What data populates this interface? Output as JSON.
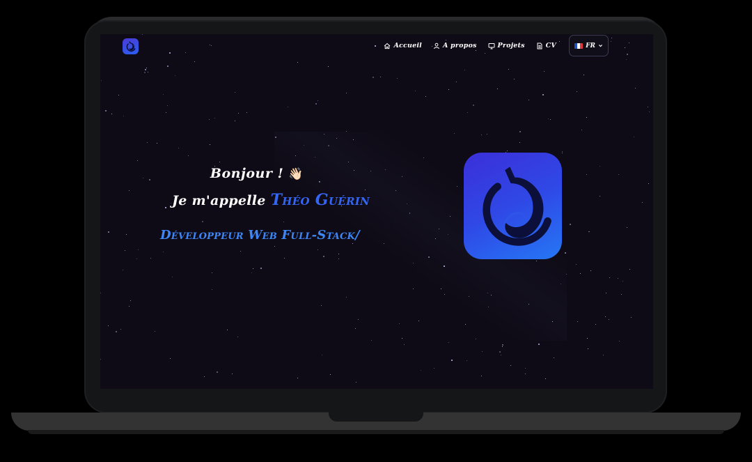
{
  "nav": {
    "items": [
      {
        "label": "Accueil",
        "icon": "home-icon"
      },
      {
        "label": "A propos",
        "icon": "user-icon"
      },
      {
        "label": "Projets",
        "icon": "monitor-icon"
      },
      {
        "label": "CV",
        "icon": "document-icon"
      }
    ],
    "language": {
      "label": "FR",
      "flag": "france-flag-icon"
    }
  },
  "hero": {
    "greeting": "Bonjour !",
    "wave_emoji": "👋🏻",
    "intro_prefix": "Je m'appelle ",
    "name": "Théo Guérin",
    "role": "Développeur Web Full-Stack/"
  },
  "colors": {
    "background": "#0e0b16",
    "accent_name": "#3566f2",
    "accent_role": "#3f86f5",
    "logo_gradient_start": "#3b2fd9",
    "logo_gradient_end": "#2577f4",
    "logo_mark": "#0b0f3a"
  }
}
